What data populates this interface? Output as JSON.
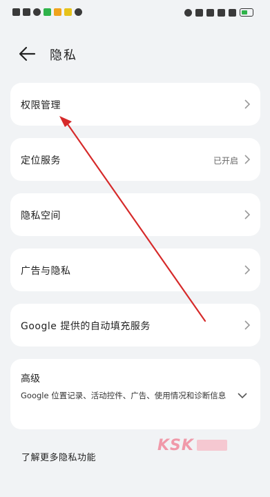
{
  "header": {
    "title": "隐私"
  },
  "items": [
    {
      "label": "权限管理"
    },
    {
      "label": "定位服务",
      "value": "已开启"
    },
    {
      "label": "隐私空间"
    },
    {
      "label": "广告与隐私"
    },
    {
      "label": "Google 提供的自动填充服务"
    }
  ],
  "advanced": {
    "title": "高级",
    "description": "Google 位置记录、活动控件、广告、使用情况和诊断信息"
  },
  "learn_more": "了解更多隐私功能",
  "watermark": {
    "text": "KSK"
  },
  "colors": {
    "background": "#f1f3f5",
    "card": "#ffffff",
    "annotation": "#d62a2a"
  }
}
